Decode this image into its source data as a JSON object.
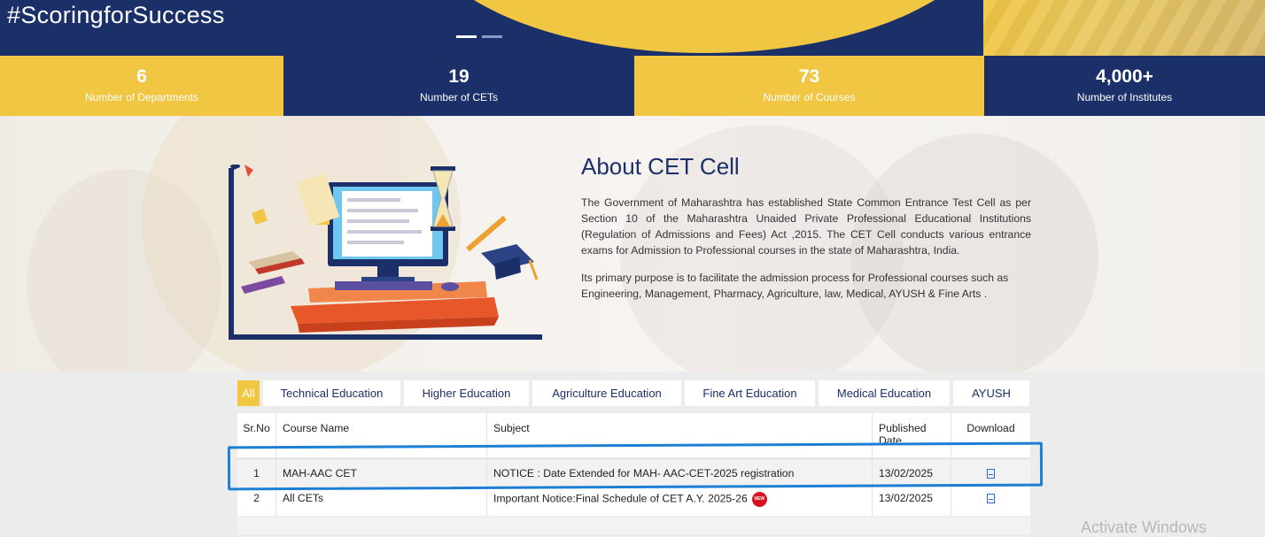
{
  "hero": {
    "hashtag": "#ScoringforSuccess",
    "slider_dots": 2,
    "colors": {
      "navy": "#1b3068",
      "gold": "#f0c642"
    }
  },
  "stats": [
    {
      "value": "6",
      "label": "Number of Departments",
      "bg": "gold"
    },
    {
      "value": "19",
      "label": "Number of CETs",
      "bg": "navy"
    },
    {
      "value": "73",
      "label": "Number of Courses",
      "bg": "gold"
    },
    {
      "value": "4,000+",
      "label": "Number of Institutes",
      "bg": "navy"
    }
  ],
  "about": {
    "title": "About CET Cell",
    "paragraph1": "The Government of Maharashtra has established State Common Entrance Test Cell as per Section 10 of the Maharashtra Unaided Private Professional Educational Institutions (Regulation of Admissions and Fees) Act ,2015. The CET Cell conducts various entrance exams for Admission to Professional courses in the state of Maharashtra, India.",
    "paragraph2": "Its primary purpose is to facilitate the admission process for Professional courses such as Engineering, Management, Pharmacy, Agriculture, law, Medical, AYUSH & Fine Arts ."
  },
  "tabs": [
    "All",
    "Technical Education",
    "Higher Education",
    "Agriculture Education",
    "Fine Art Education",
    "Medical Education",
    "AYUSH"
  ],
  "active_tab": "All",
  "table": {
    "headers": {
      "srno": "Sr.No",
      "course": "Course Name",
      "subject": "Subject",
      "published": "Published Date",
      "download": "Download"
    },
    "rows": [
      {
        "srno": "1",
        "course": "MAH-AAC CET",
        "subject": "NOTICE : Date Extended for MAH- AAC-CET-2025 registration",
        "published": "13/02/2025",
        "download_icon": "pdf-icon",
        "is_new": false
      },
      {
        "srno": "2",
        "course": "All CETs",
        "subject": "Important Notice:Final Schedule of CET A.Y. 2025-26",
        "published": "13/02/2025",
        "download_icon": "pdf-icon",
        "is_new": true,
        "new_badge": "NEW"
      }
    ]
  },
  "watermark": "Activate Windows"
}
